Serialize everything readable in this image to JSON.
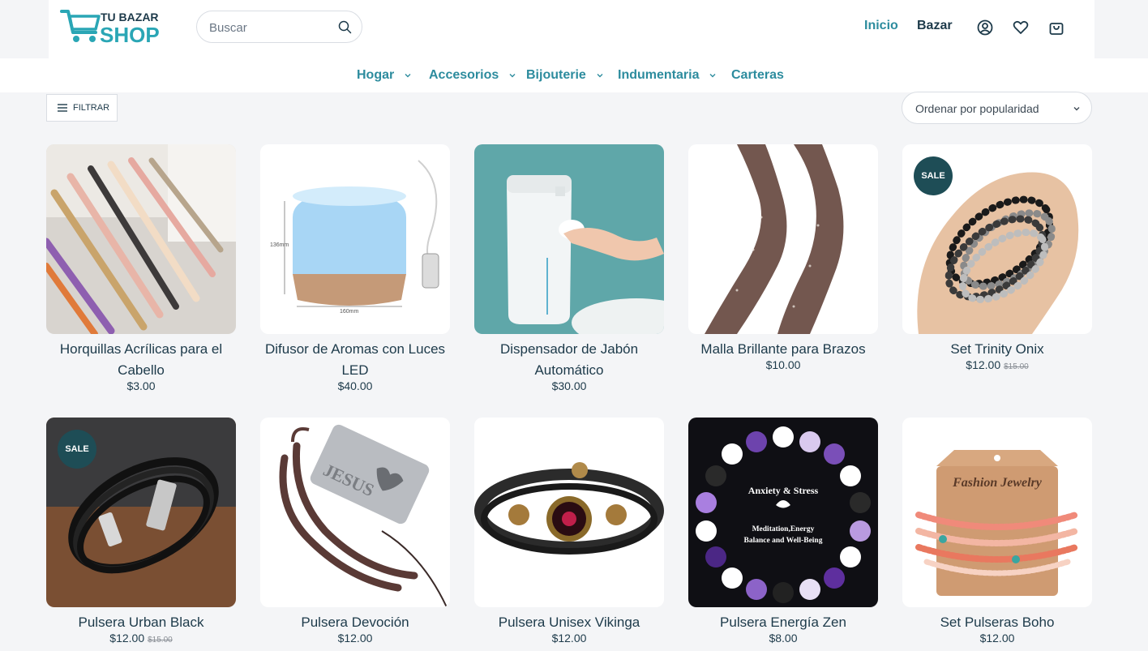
{
  "header": {
    "logo_top": "TU BAZAR",
    "logo_bottom": "SHOP",
    "search_placeholder": "Buscar",
    "nav": [
      {
        "label": "Inicio"
      },
      {
        "label": "Bazar"
      }
    ],
    "icons": [
      "account-icon",
      "wishlist-heart-icon",
      "cart-bag-icon"
    ]
  },
  "categories": [
    {
      "label": "Hogar",
      "dropdown": true
    },
    {
      "label": "Accesorios",
      "dropdown": true
    },
    {
      "label": "Bijouterie",
      "dropdown": true
    },
    {
      "label": "Indumentaria",
      "dropdown": true
    },
    {
      "label": "Carteras",
      "dropdown": false
    }
  ],
  "toolbar": {
    "filter_label": "FILTRAR",
    "sort_label": "Ordenar por popularidad"
  },
  "sale_badge": "SALE",
  "products": [
    {
      "name": "Horquillas Acrílicas para el Cabello",
      "price": "$3.00",
      "old_price": "",
      "sale": false
    },
    {
      "name": "Difusor de Aromas con Luces LED",
      "price": "$40.00",
      "old_price": "",
      "sale": false
    },
    {
      "name": "Dispensador de Jabón Automático",
      "price": "$30.00",
      "old_price": "",
      "sale": false
    },
    {
      "name": "Malla Brillante para Brazos",
      "price": "$10.00",
      "old_price": "",
      "sale": false
    },
    {
      "name": "Set Trinity Onix",
      "price": "$12.00",
      "old_price": "$15.00",
      "sale": true
    },
    {
      "name": "Pulsera Urban Black",
      "price": "$12.00",
      "old_price": "$15.00",
      "sale": true
    },
    {
      "name": "Pulsera Devoción",
      "price": "$12.00",
      "old_price": "",
      "sale": false
    },
    {
      "name": "Pulsera Unisex Vikinga",
      "price": "$12.00",
      "old_price": "",
      "sale": false
    },
    {
      "name": "Pulsera Energía Zen",
      "price": "$8.00",
      "old_price": "",
      "sale": false
    },
    {
      "name": "Set Pulseras Boho",
      "price": "$12.00",
      "old_price": "",
      "sale": false
    }
  ],
  "image_text": {
    "p2_height": "136mm",
    "p2_width": "160mm",
    "p7_text": "JESUS",
    "p9_line1": "Anxiety & Stress",
    "p9_line2": "Meditation,Energy",
    "p9_line3": "Balance and Well-Being",
    "p10_text": "Fashion Jewelry"
  },
  "colors": {
    "brand": "#2d8c9e",
    "text_dark": "#1d3a4a",
    "sale_badge": "#1e4d56"
  }
}
